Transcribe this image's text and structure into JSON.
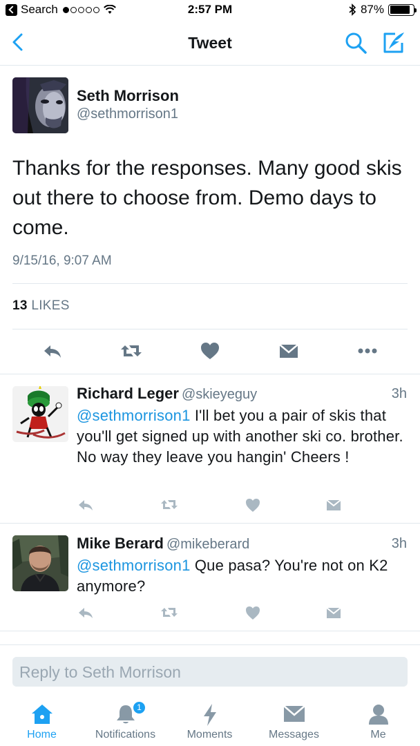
{
  "status_bar": {
    "back_app": "Search",
    "time": "2:57 PM",
    "battery": "87%",
    "battery_level": 0.87
  },
  "nav": {
    "title": "Tweet",
    "icons": [
      "back-chevron-icon",
      "search-icon",
      "compose-tweet-icon"
    ]
  },
  "tweet": {
    "author_name": "Seth Morrison",
    "author_handle": "@sethmorrison1",
    "text": "Thanks for the responses.  Many good skis out there to choose from.  Demo days to come.",
    "date": "9/15/16, 9:07 AM",
    "likes_count": "13",
    "likes_label": "LIKES",
    "actions": [
      "reply-icon",
      "retweet-icon",
      "like-icon",
      "direct-message-icon",
      "more-icon"
    ]
  },
  "replies": [
    {
      "name": "Richard Leger",
      "handle": "@skieyeguy",
      "time": "3h",
      "mention": "@sethmorrison1",
      "text": " I'll bet you a pair of skis that you'll get signed up with another ski co. brother. No way they leave you hangin' Cheers !"
    },
    {
      "name": "Mike Berard",
      "handle": "@mikeberard",
      "time": "3h",
      "mention": "@sethmorrison1",
      "text": " Que pasa? You're not on K2 anymore?"
    }
  ],
  "reply_box": {
    "placeholder": "Reply to Seth Morrison"
  },
  "tab_bar": {
    "tabs": [
      {
        "label": "Home",
        "icon": "home-icon",
        "active": true
      },
      {
        "label": "Notifications",
        "icon": "bell-icon",
        "badge": "1"
      },
      {
        "label": "Moments",
        "icon": "lightning-icon"
      },
      {
        "label": "Messages",
        "icon": "envelope-icon"
      },
      {
        "label": "Me",
        "icon": "person-icon"
      }
    ]
  },
  "colors": {
    "accent": "#1da1f2",
    "link": "#1b95e0",
    "secondary_text": "#657786",
    "icon_gray": "#8899a6",
    "reply_icon_gray": "#aab8c2"
  }
}
